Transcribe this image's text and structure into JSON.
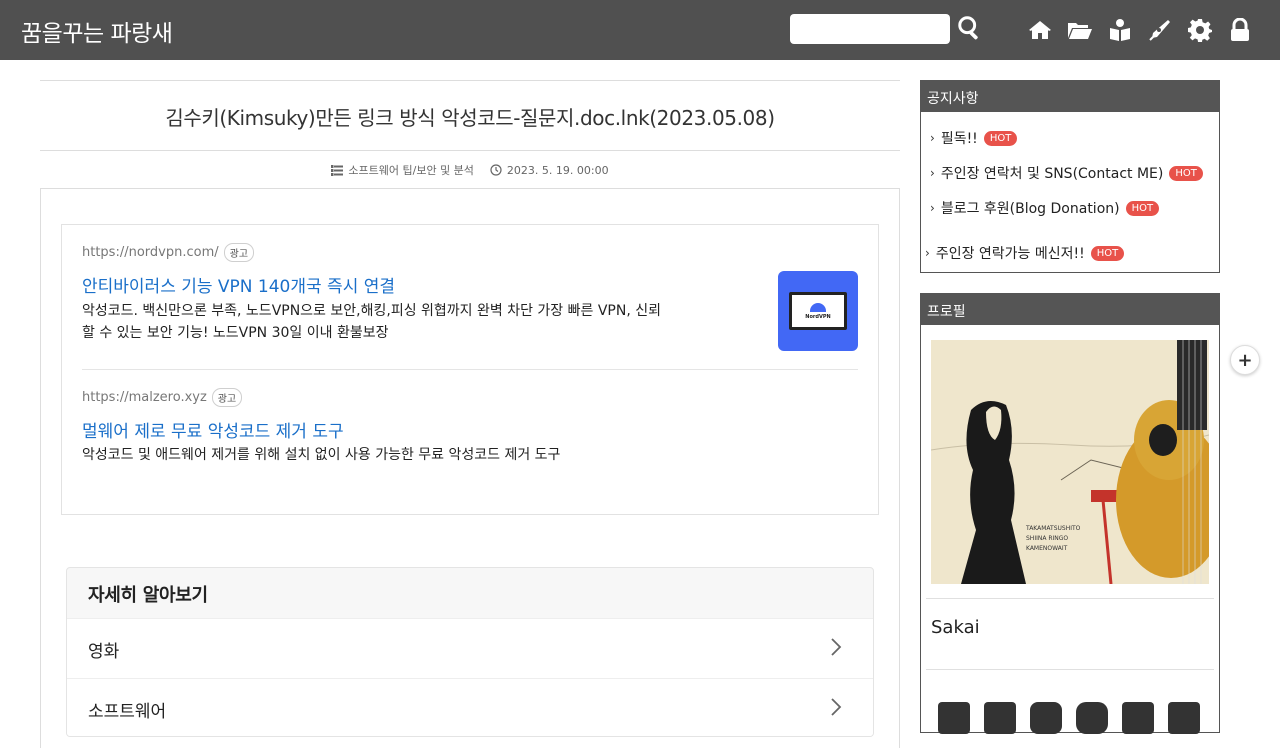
{
  "header": {
    "site_title": "꿈을꾸는 파랑새",
    "search": {
      "value": "",
      "placeholder": ""
    },
    "icons": [
      "search-icon",
      "home-icon",
      "folder-icon",
      "guestbook-icon",
      "write-icon",
      "settings-icon",
      "lock-icon"
    ]
  },
  "post": {
    "title": "김수키(Kimsuky)만든 링크 방식 악성코드-질문지.doc.lnk(2023.05.08)",
    "category": "소프트웨어 팁/보안 및 분석",
    "date": "2023. 5. 19. 00:00"
  },
  "ads": {
    "badge_label": "광고",
    "items": [
      {
        "url": "https://nordvpn.com/",
        "headline": "안티바이러스 기능 VPN 140개국 즉시 연결",
        "desc_line1": "악성코드. 백신만으론 부족, 노드VPN으로 보안,해킹,피싱 위협까지 완벽 차단 가장 빠른 VPN, 신뢰",
        "desc_line2": "할 수 있는 보안 기능! 노드VPN 30일 이내 환불보장",
        "thumb_text": "NordVPN"
      },
      {
        "url": "https://malzero.xyz",
        "headline": "멀웨어 제로 무료 악성코드 제거 도구",
        "desc_line1": "악성코드 및 애드웨어 제거를 위해 설치 없이 사용 가능한 무료 악성코드 제거 도구"
      }
    ]
  },
  "learn_more": {
    "title": "자세히 알아보기",
    "items": [
      {
        "label": "영화"
      },
      {
        "label": "소프트웨어"
      }
    ]
  },
  "sidebar": {
    "notice": {
      "title": "공지사항",
      "hot_label": "HOT",
      "items": [
        {
          "label": "필독!!"
        },
        {
          "label": "주인장 연락처 및 SNS(Contact ME)"
        },
        {
          "label": "블로그 후원(Blog Donation)"
        },
        {
          "label": "주인장 연락가능 메신저!!"
        }
      ]
    },
    "profile": {
      "title": "프로필",
      "name": "Sakai",
      "social_icons": [
        "twitter-icon",
        "facebook-icon",
        "instagram-icon",
        "youtube-icon",
        "kakao-icon",
        "mail-icon"
      ]
    }
  },
  "colors": {
    "header_bg": "#505050",
    "widget_head_bg": "#555555",
    "ad_link": "#1a6fc9",
    "hot_badge": "#e8524a",
    "ad_thumb_bg": "#4268f5"
  }
}
